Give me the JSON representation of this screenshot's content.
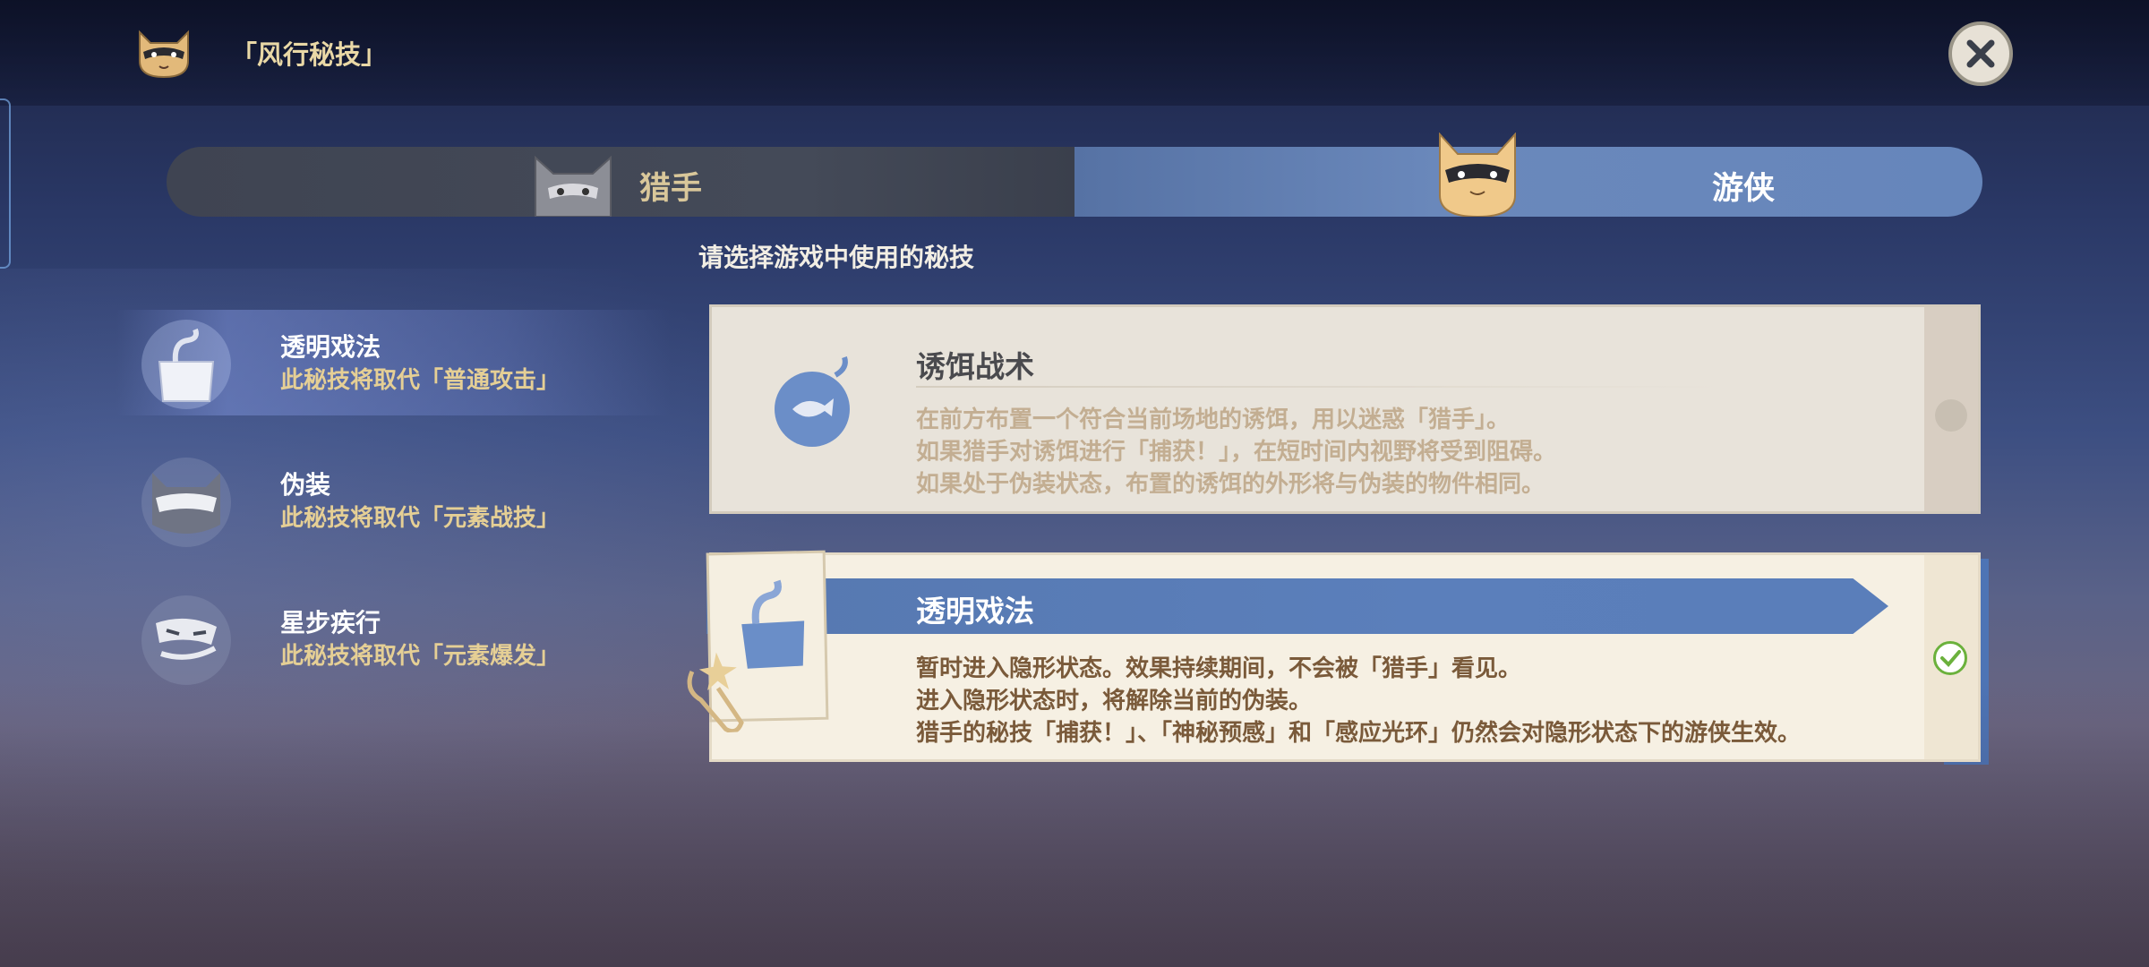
{
  "header": {
    "title": "「风行秘技」",
    "icon": "cat-mask-icon",
    "close_icon": "close-icon"
  },
  "tabs": [
    {
      "label": "猎手",
      "avatar": "hunter-cat-avatar",
      "selected": false
    },
    {
      "label": "游侠",
      "avatar": "ranger-cat-avatar",
      "selected": true
    }
  ],
  "hint": "请选择游戏中使用的秘技",
  "skills": [
    {
      "name": "透明戏法",
      "desc": "此秘技将取代「普通攻击」",
      "icon": "invisible-box-icon",
      "selected": true
    },
    {
      "name": "伪装",
      "desc": "此秘技将取代「元素战技」",
      "icon": "disguise-mask-icon",
      "selected": false
    },
    {
      "name": "星步疾行",
      "desc": "此秘技将取代「元素爆发」",
      "icon": "star-step-icon",
      "selected": false
    }
  ],
  "cards": [
    {
      "title": "诱饵战术",
      "icon": "fish-bait-icon",
      "lines": [
        "在前方布置一个符合当前场地的诱饵，用以迷惑「猎手」。",
        "如果猎手对诱饵进行「捕获！」，在短时间内视野将受到阻碍。",
        "如果处于伪装状态，布置的诱饵的外形将与伪装的物件相同。"
      ],
      "selected": false
    },
    {
      "title": "透明戏法",
      "icon": "invisible-box-icon",
      "lines": [
        "暂时进入隐形状态。效果持续期间，不会被「猎手」看见。",
        "进入隐形状态时，将解除当前的伪装。",
        "猎手的秘技「捕获！」、「神秘预感」和「感应光环」仍然会对隐形状态下的游侠生效。"
      ],
      "selected": true
    }
  ],
  "colors": {
    "accent": "#5a7eba",
    "gold": "#e5cf95",
    "check": "#6bb13c"
  }
}
